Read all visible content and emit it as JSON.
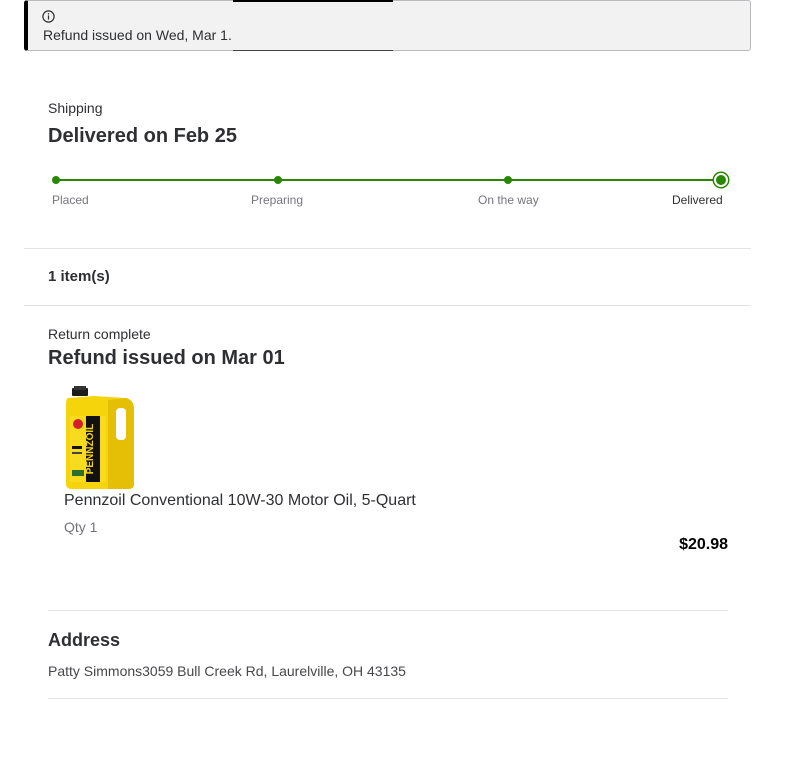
{
  "alert": {
    "icon": "info-icon",
    "message": "Refund issued on Wed, Mar 1."
  },
  "shipping": {
    "label": "Shipping",
    "title": "Delivered on Feb 25",
    "steps": [
      "Placed",
      "Preparing",
      "On the way",
      "Delivered"
    ],
    "current_step": "Delivered",
    "accent_color": "#2a8703"
  },
  "items": {
    "count_label": "1 item(s)"
  },
  "return": {
    "status": "Return complete",
    "title": "Refund issued on Mar 01",
    "product": {
      "image": "motor-oil-bottle-image",
      "brand_text": "PENNZOIL",
      "name": "Pennzoil Conventional 10W-30 Motor Oil, 5-Quart",
      "qty": "Qty 1",
      "price": "$20.98"
    }
  },
  "address": {
    "title": "Address",
    "text": "Patty Simmons3059 Bull Creek Rd, Laurelville, OH 43135"
  }
}
